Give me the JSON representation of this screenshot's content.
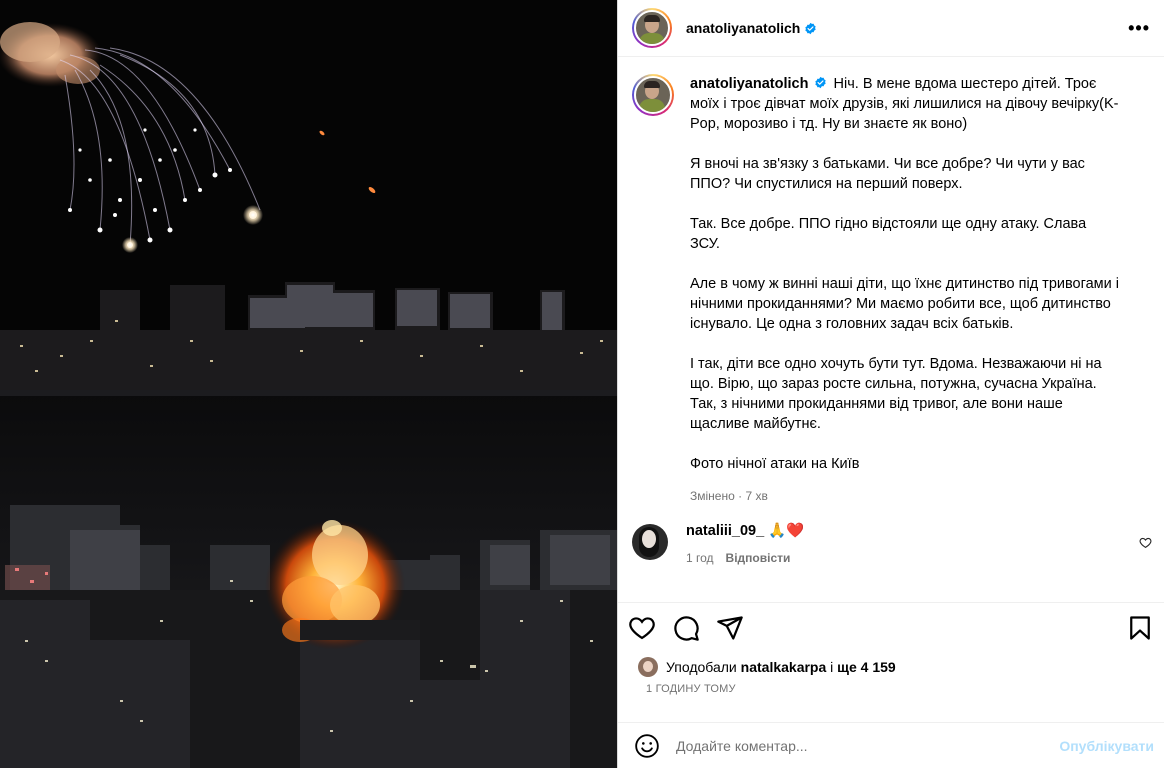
{
  "post": {
    "author": "anatoliyanatolich",
    "verified": true,
    "more_label": "•••"
  },
  "caption": {
    "author": "anatoliyanatolich",
    "paragraphs": [
      "Ніч. В мене вдома шестеро дітей. Троє моїх і троє дівчат моїх друзів, які лишилися на дівочу вечірку(K-Pop, морозиво і тд. Ну ви знаєте як воно)",
      "Я вночі на зв'язку з батьками. Чи все добре? Чи чути у вас ППО? Чи спустилися на перший поверх.",
      "Так. Все добре. ППО гідно відстояли ще одну атаку. Слава ЗСУ.",
      "Але в чому ж винні наші діти, що їхнє дитинство під тривогами і нічними прокиданнями? Ми маємо робити все, щоб дитинство існувало. Це одна з головних задач всіх батьків.",
      "І так, діти все одно хочуть бути тут. Вдома. Незважаючи ні на що. Вірю, що зараз росте сильна, потужна, сучасна Україна. Так, з нічними прокиданнями від тривог, але вони наше щасливе майбутнє.",
      "Фото нічної атаки на Київ"
    ],
    "edited": "Змінено",
    "edited_sep": "·",
    "time": "7 хв"
  },
  "comment": {
    "author": "nataliii_09_",
    "emojis": "🙏❤️",
    "time": "1 год",
    "reply_label": "Відповісти"
  },
  "likes": {
    "prefix": "Уподобали",
    "user": "natalkakarpa",
    "middle": "і",
    "others": "ще 4 159"
  },
  "posted_ago": "1 ГОДИНУ ТОМУ",
  "add_comment": {
    "placeholder": "Додайте коментар...",
    "post_label": "Опублікувати"
  },
  "colors": {
    "verified": "#0095f6",
    "muted": "#737373",
    "post_disabled": "#b2dffc",
    "heart": "#ed4956"
  }
}
